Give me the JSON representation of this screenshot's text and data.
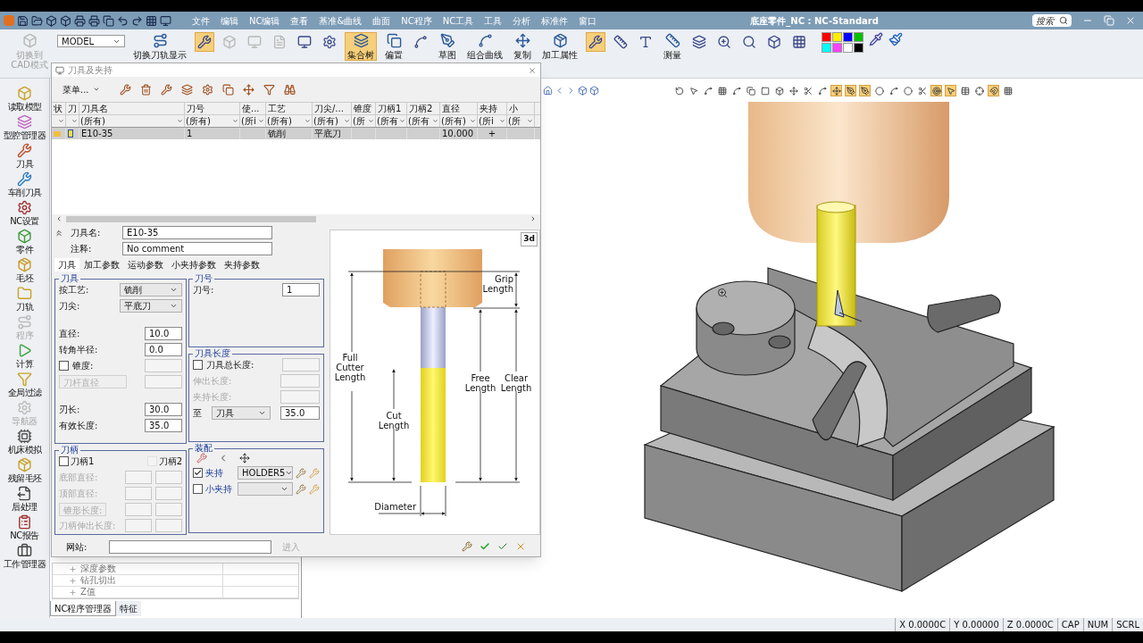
{
  "title_bar": {
    "menus": [
      "文件",
      "编辑",
      "NC编辑",
      "查看",
      "基准&曲线",
      "曲面",
      "NC程序",
      "NC工具",
      "工具",
      "分析",
      "标准件",
      "窗口"
    ],
    "title": "底座零件_NC : NC-Standard",
    "search_placeholder": "搜索"
  },
  "ribbon": [
    {
      "kind": "button",
      "label": "切换到CAD模式",
      "active": false,
      "disabled": true
    },
    {
      "kind": "select",
      "value": "MODEL"
    },
    {
      "kind": "button",
      "label": "切换刀轨显示",
      "active": false,
      "disabled": false
    },
    {
      "kind": "icon",
      "active": true,
      "disabled": false
    },
    {
      "kind": "icon",
      "active": false,
      "disabled": true
    },
    {
      "kind": "icon",
      "active": false,
      "disabled": true
    },
    {
      "kind": "icon",
      "active": false,
      "disabled": true
    },
    {
      "kind": "icon",
      "active": false,
      "disabled": false
    },
    {
      "kind": "icon",
      "active": false,
      "disabled": false
    },
    {
      "kind": "button",
      "label": "集合树",
      "active": true,
      "disabled": false
    },
    {
      "kind": "button",
      "label": "偏置",
      "active": false,
      "disabled": false
    },
    {
      "kind": "icon",
      "active": false,
      "disabled": false
    },
    {
      "kind": "button",
      "label": "草图",
      "active": false,
      "disabled": false
    },
    {
      "kind": "button",
      "label": "组合曲线",
      "active": false,
      "disabled": false
    },
    {
      "kind": "button",
      "label": "复制",
      "active": false,
      "disabled": false
    },
    {
      "kind": "button",
      "label": "加工属性",
      "active": false,
      "disabled": false
    },
    {
      "kind": "icon",
      "active": true,
      "disabled": false
    },
    {
      "kind": "icon",
      "active": false,
      "disabled": false
    },
    {
      "kind": "icon",
      "active": false,
      "disabled": false
    },
    {
      "kind": "button",
      "label": "测量",
      "active": false,
      "disabled": false
    },
    {
      "kind": "icon",
      "active": false,
      "disabled": false
    },
    {
      "kind": "icon",
      "active": false,
      "disabled": false
    },
    {
      "kind": "icon",
      "active": false,
      "disabled": false
    },
    {
      "kind": "icon",
      "active": false,
      "disabled": false
    },
    {
      "kind": "icon",
      "active": false,
      "disabled": false
    }
  ],
  "sidebar": [
    {
      "label": "读取模型",
      "disabled": false
    },
    {
      "label": "型腔管理器",
      "disabled": false
    },
    {
      "label": "刀具",
      "disabled": false
    },
    {
      "label": "车削刀具",
      "disabled": false
    },
    {
      "label": "NC设置",
      "disabled": false
    },
    {
      "label": "零件",
      "disabled": false
    },
    {
      "label": "毛坯",
      "disabled": false
    },
    {
      "label": "刀轨",
      "disabled": false
    },
    {
      "label": "程序",
      "disabled": true
    },
    {
      "label": "计算",
      "disabled": false
    },
    {
      "label": "全局过滤",
      "disabled": false
    },
    {
      "label": "导航器",
      "disabled": true
    },
    {
      "label": "机床模拟",
      "disabled": false
    },
    {
      "label": "残留毛坯",
      "disabled": false
    },
    {
      "label": "后处理",
      "disabled": false
    },
    {
      "label": "NC报告",
      "disabled": false
    },
    {
      "label": "工作管理器",
      "disabled": false
    }
  ],
  "dialog": {
    "title": "刀具及夹持",
    "menu": "菜单...",
    "table": {
      "columns": [
        {
          "label": "状"
        },
        {
          "label": "刀"
        },
        {
          "label": "刀具名",
          "filter": "(所有)"
        },
        {
          "label": "刀号",
          "filter": "(所有)"
        },
        {
          "label": "使...",
          "filter": "(所i"
        },
        {
          "label": "工艺",
          "filter": "(所有)"
        },
        {
          "label": "刀尖/...",
          "filter": "(所有)"
        },
        {
          "label": "锥度",
          "filter": "(所"
        },
        {
          "label": "刀柄1",
          "filter": "(所有"
        },
        {
          "label": "刀柄2",
          "filter": "(所有"
        },
        {
          "label": "直径",
          "filter": "(所有)"
        },
        {
          "label": "夹持",
          "filter": "(所i"
        },
        {
          "label": "小",
          "filter": "(所"
        }
      ],
      "rows": [
        {
          "selected": true,
          "cells": [
            null,
            null,
            "E10-35",
            "1",
            null,
            "铣削",
            "平底刀",
            null,
            null,
            null,
            "10.000",
            "+",
            null
          ]
        }
      ]
    },
    "form": {
      "name": {
        "label": "刀具名:",
        "value": "E10-35"
      },
      "comment": {
        "label": "注释:",
        "value": "No comment"
      },
      "tabs": [
        {
          "label": "刀具",
          "selected": true
        },
        {
          "label": "加工参数",
          "selected": false
        },
        {
          "label": "运动参数",
          "selected": false
        },
        {
          "label": "小夹持参数",
          "selected": false
        },
        {
          "label": "夹持参数",
          "selected": false
        }
      ],
      "groups": [
        {
          "title": "刀具",
          "rows": [
            {
              "kind": "select",
              "label": "按工艺:",
              "value": "铣削"
            },
            {
              "kind": "select",
              "label": "刀尖:",
              "value": "平底刀"
            },
            {
              "kind": "gap"
            },
            {
              "kind": "input",
              "label": "直径:",
              "value": "10.0"
            },
            {
              "kind": "input",
              "label": "转角半径:",
              "value": "0.0"
            },
            {
              "kind": "check-input",
              "label": "锥度:",
              "checked": false
            },
            {
              "kind": "button-input",
              "label": "刀杆直径"
            },
            {
              "kind": "gap"
            },
            {
              "kind": "input",
              "label": "刃长:",
              "value": "30.0"
            },
            {
              "kind": "input",
              "label": "有效长度:",
              "value": "35.0"
            }
          ]
        },
        {
          "title": "刀号",
          "rows": [
            {
              "kind": "input",
              "label": "刀号:",
              "value": "1"
            }
          ]
        },
        {
          "title": "刀具长度",
          "rows": [
            {
              "kind": "check-input",
              "label": "刀具总长度:",
              "checked": false
            },
            {
              "kind": "disabled-input",
              "label": "伸出长度:"
            },
            {
              "kind": "disabled-input",
              "label": "夹持长度:"
            },
            {
              "kind": "select-input",
              "label": "至",
              "value": "刀具",
              "number": "35.0"
            }
          ]
        },
        {
          "title": "刀柄",
          "rows": [
            {
              "kind": "check-pair",
              "items": [
                {
                  "label": "刀柄1",
                  "checked": false,
                  "disabled": false
                },
                {
                  "label": "刀柄2",
                  "checked": false,
                  "disabled": true
                }
              ]
            },
            {
              "kind": "disabled-pair",
              "label": "底部直径:"
            },
            {
              "kind": "disabled-pair",
              "label": "顶部直径:"
            },
            {
              "kind": "button-pair",
              "label": "锥形长度:"
            },
            {
              "kind": "disabled-pair",
              "label": "刀柄伸出长度:"
            }
          ]
        },
        {
          "title": "装配",
          "rows": [
            {
              "kind": "tools"
            },
            {
              "kind": "check-select",
              "label": "夹持",
              "checked": true,
              "value": "HOLDER5"
            },
            {
              "kind": "check-select",
              "label": "小夹持",
              "checked": false
            }
          ]
        }
      ],
      "website": {
        "label": "网站:",
        "action": "进入"
      }
    },
    "diagram": {
      "view_button": "3d",
      "labels": [
        {
          "kind": "grip",
          "lines": [
            "Grip",
            "Length"
          ]
        },
        {
          "kind": "full",
          "lines": [
            "Full",
            "Cutter",
            "Length"
          ]
        },
        {
          "kind": "free",
          "lines": [
            "Free",
            "Length"
          ]
        },
        {
          "kind": "clear",
          "lines": [
            "Clear",
            "Length"
          ]
        },
        {
          "kind": "cut",
          "lines": [
            "Cut",
            "Length"
          ]
        },
        {
          "kind": "diameter",
          "lines": [
            "Diameter"
          ]
        }
      ]
    }
  },
  "tree": [
    "深度参数",
    "钻孔切出",
    "Z值"
  ],
  "panel_tabs": [
    {
      "label": "NC程序管理器",
      "selected": true
    },
    {
      "label": "特征",
      "selected": false
    }
  ],
  "view_toolbar": [
    {
      "active": false
    },
    {
      "active": false
    },
    {
      "active": false
    },
    {
      "active": false
    },
    {
      "active": false
    },
    {
      "active": false
    },
    {
      "active": false
    },
    {
      "active": false
    },
    {
      "active": false
    },
    {
      "active": false
    },
    {
      "active": false
    },
    {
      "active": true
    },
    {
      "active": true
    },
    {
      "active": true
    },
    {
      "active": false
    },
    {
      "active": false
    },
    {
      "active": false
    },
    {
      "active": false
    },
    {
      "active": true
    },
    {
      "active": true
    },
    {
      "active": false
    },
    {
      "active": false
    },
    {
      "active": true
    },
    {
      "active": false
    }
  ],
  "status_bar": [
    "X 0.0000C",
    "Y 0.00000",
    "Z 0.0000C",
    "CAP",
    "NUM",
    "SCRL"
  ]
}
